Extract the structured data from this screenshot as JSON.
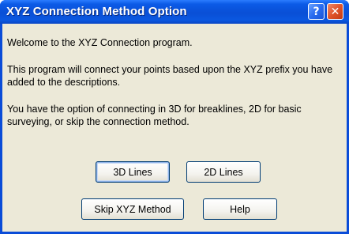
{
  "window": {
    "title": "XYZ Connection Method Option",
    "help_glyph": "?",
    "close_glyph": "✕"
  },
  "messages": [
    "Welcome to the XYZ Connection program.",
    "This program will connect your points based upon the XYZ prefix you have added to the descriptions.",
    "You have the option of connecting in 3D for breaklines, 2D for basic surveying, or skip the connection method."
  ],
  "buttons": {
    "lines_3d": "3D Lines",
    "lines_2d": "2D Lines",
    "skip": "Skip XYZ Method",
    "help": "Help"
  },
  "icons": {
    "help": "question-mark-icon",
    "close": "close-x-icon"
  },
  "colors": {
    "titlebar": "#0a4fd6",
    "dialog_bg": "#ece9d8",
    "close_button": "#e0532a"
  }
}
